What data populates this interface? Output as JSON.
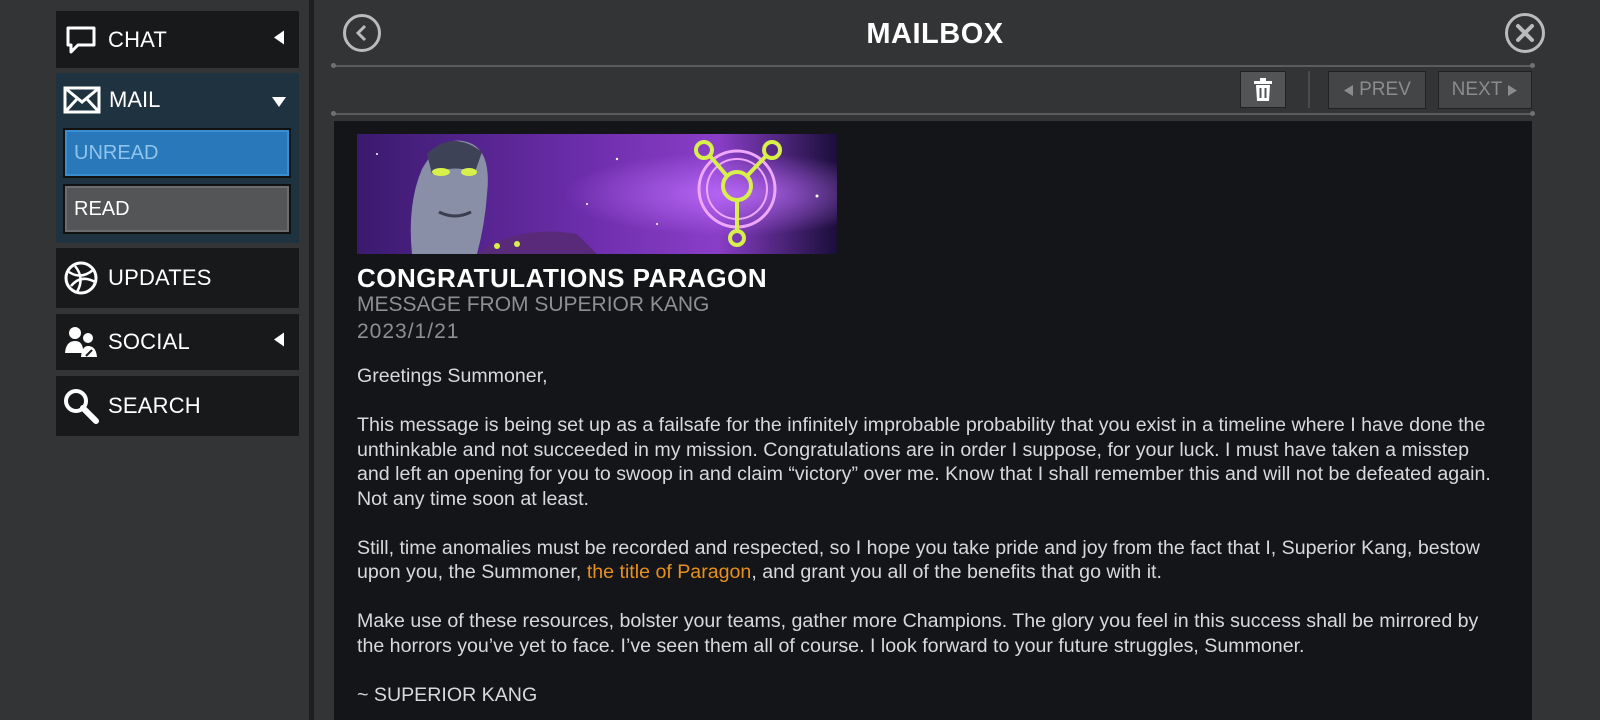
{
  "sidebar": {
    "chat": {
      "label": "CHAT",
      "icon": "chat-bubble-icon"
    },
    "mail": {
      "label": "MAIL",
      "icon": "envelope-icon"
    },
    "mail_sub": {
      "unread": "UNREAD",
      "read": "READ"
    },
    "updates": {
      "label": "UPDATES",
      "icon": "globe-icon"
    },
    "social": {
      "label": "SOCIAL",
      "icon": "people-icon"
    },
    "search": {
      "label": "SEARCH",
      "icon": "search-icon"
    }
  },
  "header": {
    "title": "MAILBOX"
  },
  "toolbar": {
    "prev": "PREV",
    "next": "NEXT"
  },
  "message": {
    "title": "CONGRATULATIONS PARAGON",
    "from": "MESSAGE FROM SUPERIOR KANG",
    "date": "2023/1/21",
    "greeting": "Greetings Summoner,",
    "para1": "This message is being set up as a failsafe for the infinitely improbable probability that you exist in a timeline where I have done the unthinkable and not succeeded in my mission. Congratulations are in order I suppose, for your luck. I must have taken a misstep and left an opening for you to swoop in and claim “victory” over me. Know that I shall remember this and will not be defeated again. Not any time soon at least.",
    "para2_start": "Still, time anomalies must be recorded and respected, so I hope you take pride and joy from the fact that I, Superior Kang, bestow upon you, the Summoner, ",
    "para2_link": "the title of Paragon",
    "para2_end": ", and grant you all of the benefits that go with it.",
    "para3": "Make use of these resources, bolster your teams, gather more Champions. The glory you feel in this success shall be mirrored by the horrors you’ve yet to face. I’ve seen them all of course. I look forward to your future struggles, Summoner.",
    "signature": "~ SUPERIOR KANG"
  },
  "colors": {
    "accent_blue": "#2979ba",
    "link_orange": "#e8901e",
    "panel_bg": "#131518"
  }
}
